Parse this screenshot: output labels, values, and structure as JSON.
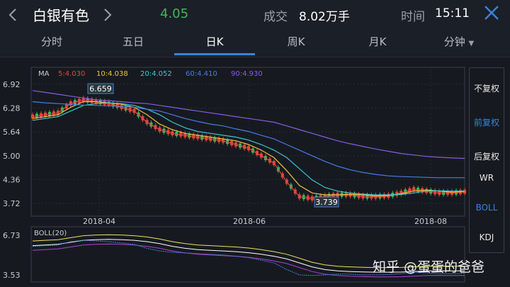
{
  "header": {
    "back_icon": "chevron-left-icon",
    "forward_icon": "chevron-right-icon",
    "stock_name": "白银有色",
    "price": "4.05",
    "volume_label": "成交",
    "volume_value": "8.02万手",
    "time_label": "时间",
    "time_value": "15:11",
    "close_icon": "close-icon",
    "colors": {
      "up": "#e0463a",
      "down": "#3db85c",
      "accent": "#3a82d8"
    }
  },
  "tabs": [
    {
      "label": "分时"
    },
    {
      "label": "五日"
    },
    {
      "label": "日K",
      "active": true
    },
    {
      "label": "周K"
    },
    {
      "label": "月K"
    },
    {
      "label": "分钟"
    }
  ],
  "ma_legend": {
    "label": "MA",
    "items": [
      {
        "text": "5:4.030",
        "color": "#e0463a"
      },
      {
        "text": "10:4.038",
        "color": "#f0c040"
      },
      {
        "text": "20:4.052",
        "color": "#3ec6d0"
      },
      {
        "text": "60:4.410",
        "color": "#4a7ce0"
      },
      {
        "text": "90:4.930",
        "color": "#8a5ae0"
      }
    ]
  },
  "right_panel": [
    {
      "label": "不复权"
    },
    {
      "label": "前复权",
      "active": true
    },
    {
      "label": "后复权"
    },
    {
      "label": "WR"
    },
    {
      "label": "BOLL",
      "active": true
    },
    {
      "label": "KDJ"
    }
  ],
  "chart_data": {
    "type": "line",
    "price_axis": [
      "6.92",
      "6.28",
      "5.64",
      "5.00",
      "4.36",
      "3.72"
    ],
    "ylim": [
      3.55,
      7.05
    ],
    "x_labels": [
      "2018-04",
      "2018-06",
      "2018-08"
    ],
    "high_marker": "6.659",
    "low_marker": "3.739",
    "boll_label": "BOLL(20)",
    "boll_axis": [
      "6.73",
      "3.53"
    ],
    "series": [
      {
        "name": "5",
        "values": [
          6.05,
          6.1,
          6.15,
          6.4,
          6.5,
          6.45,
          6.4,
          6.3,
          6.2,
          5.9,
          5.7,
          5.6,
          5.55,
          5.5,
          5.45,
          5.4,
          5.3,
          5.2,
          5.0,
          4.8,
          4.3,
          3.9,
          3.85,
          3.9,
          3.95,
          3.95,
          3.9,
          3.9,
          3.92,
          4.0,
          4.1,
          4.05,
          4.0,
          4.0,
          4.03
        ]
      },
      {
        "name": "10",
        "values": [
          6.0,
          6.05,
          6.1,
          6.3,
          6.45,
          6.45,
          6.42,
          6.38,
          6.3,
          6.1,
          5.85,
          5.7,
          5.6,
          5.55,
          5.5,
          5.45,
          5.4,
          5.3,
          5.15,
          4.95,
          4.6,
          4.2,
          4.0,
          3.95,
          3.95,
          3.96,
          3.95,
          3.92,
          3.93,
          3.98,
          4.05,
          4.08,
          4.05,
          4.02,
          4.04
        ]
      },
      {
        "name": "20",
        "values": [
          5.95,
          6.0,
          6.05,
          6.2,
          6.35,
          6.4,
          6.42,
          6.4,
          6.35,
          6.25,
          6.1,
          5.9,
          5.75,
          5.65,
          5.6,
          5.55,
          5.5,
          5.42,
          5.3,
          5.15,
          4.95,
          4.65,
          4.35,
          4.15,
          4.05,
          4.0,
          3.97,
          3.95,
          3.95,
          3.96,
          4.0,
          4.05,
          4.06,
          4.05,
          4.05
        ]
      },
      {
        "name": "60",
        "values": [
          6.45,
          6.42,
          6.4,
          6.38,
          6.36,
          6.35,
          6.34,
          6.33,
          6.3,
          6.25,
          6.2,
          6.1,
          6.0,
          5.92,
          5.85,
          5.8,
          5.72,
          5.65,
          5.55,
          5.45,
          5.3,
          5.15,
          5.0,
          4.85,
          4.72,
          4.62,
          4.55,
          4.5,
          4.46,
          4.44,
          4.43,
          4.42,
          4.41,
          4.41,
          4.41
        ]
      },
      {
        "name": "90",
        "values": [
          6.75,
          6.7,
          6.65,
          6.6,
          6.55,
          6.5,
          6.48,
          6.45,
          6.42,
          6.4,
          6.35,
          6.3,
          6.25,
          6.2,
          6.15,
          6.1,
          6.05,
          6.0,
          5.95,
          5.9,
          5.8,
          5.7,
          5.6,
          5.5,
          5.4,
          5.32,
          5.25,
          5.18,
          5.12,
          5.06,
          5.02,
          4.98,
          4.96,
          4.94,
          4.93
        ]
      }
    ]
  },
  "watermark": "知乎 @蛋蛋的爸爸"
}
